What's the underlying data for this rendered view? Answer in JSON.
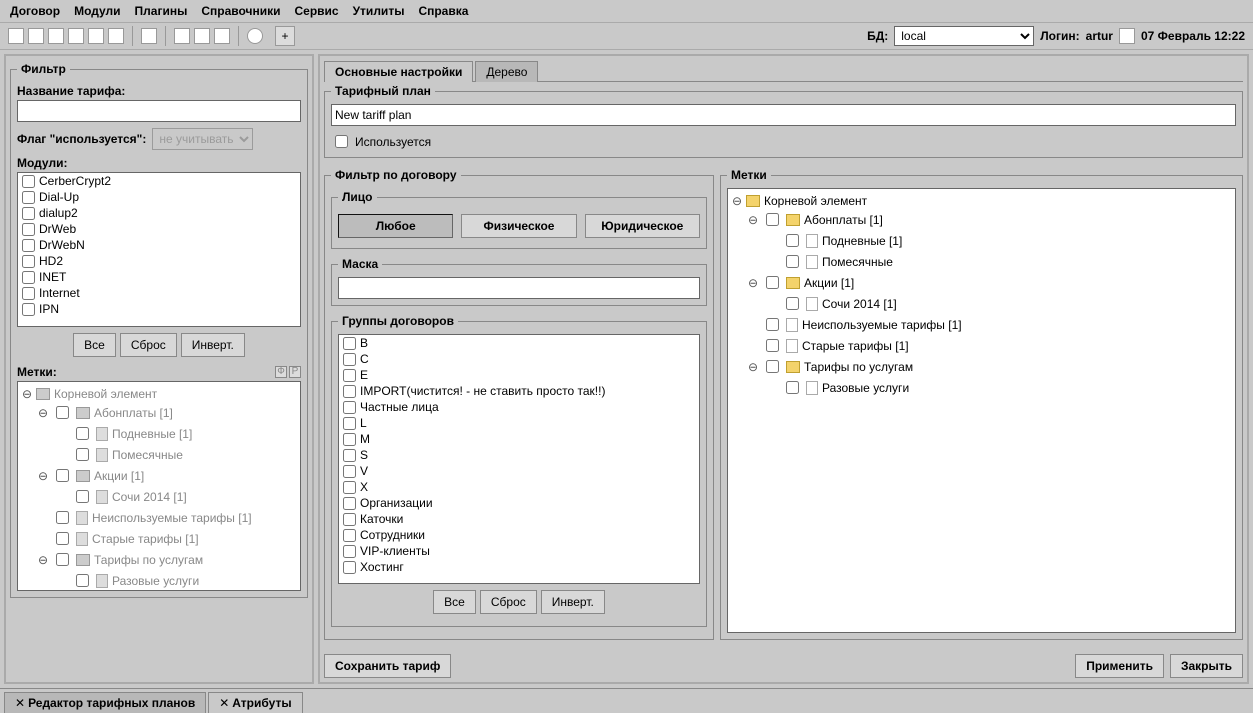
{
  "menu": [
    "Договор",
    "Модули",
    "Плагины",
    "Справочники",
    "Сервис",
    "Утилиты",
    "Справка"
  ],
  "header": {
    "bd_label": "БД:",
    "bd_value": "local",
    "login_label": "Логин:",
    "login_value": "artur",
    "date": "07 Февраль 12:22"
  },
  "filter": {
    "legend": "Фильтр",
    "tariff_name_label": "Название тарифа:",
    "tariff_name_value": "",
    "flag_label": "Флаг \"используется\":",
    "flag_value": "не учитывать",
    "modules_label": "Модули:",
    "modules": [
      "CerberCrypt2",
      "Dial-Up",
      "dialup2",
      "DrWeb",
      "DrWebN",
      "HD2",
      "INET",
      "Internet",
      "IPN"
    ],
    "btn_all": "Все",
    "btn_reset": "Сброс",
    "btn_invert": "Инверт.",
    "labels_label": "Метки:",
    "tree": [
      {
        "lvl": 0,
        "type": "root",
        "twisty": "⊖",
        "label": "Корневой элемент"
      },
      {
        "lvl": 1,
        "type": "fold",
        "twisty": "⊖",
        "cb": true,
        "label": "Абонплаты [1]"
      },
      {
        "lvl": 2,
        "type": "file",
        "cb": true,
        "label": "Подневные [1]"
      },
      {
        "lvl": 2,
        "type": "file",
        "cb": true,
        "label": "Помесячные"
      },
      {
        "lvl": 1,
        "type": "fold",
        "twisty": "⊖",
        "cb": true,
        "label": "Акции [1]"
      },
      {
        "lvl": 2,
        "type": "file",
        "cb": true,
        "label": "Сочи 2014 [1]"
      },
      {
        "lvl": 1,
        "type": "file",
        "cb": true,
        "label": "Неиспользуемые тарифы [1]"
      },
      {
        "lvl": 1,
        "type": "file",
        "cb": true,
        "label": "Старые тарифы [1]"
      },
      {
        "lvl": 1,
        "type": "fold",
        "twisty": "⊖",
        "cb": true,
        "label": "Тарифы по услугам"
      },
      {
        "lvl": 2,
        "type": "file",
        "cb": true,
        "label": "Разовые услуги"
      }
    ]
  },
  "tabs": [
    "Основные настройки",
    "Дерево"
  ],
  "active_tab": 0,
  "plan": {
    "legend": "Тарифный план",
    "name_value": "New tariff plan",
    "used_label": "Используется"
  },
  "contract_filter": {
    "legend": "Фильтр по договору",
    "face_legend": "Лицо",
    "face_buttons": [
      "Любое",
      "Физическое",
      "Юридическое"
    ],
    "face_active": 0,
    "mask_legend": "Маска",
    "mask_value": "",
    "groups_legend": "Группы договоров",
    "groups": [
      "B",
      "C",
      "E",
      "IMPORT(чистится! - не ставить просто так!!)",
      "Частные лица",
      "L",
      "M",
      "S",
      "V",
      "X",
      "Организации",
      "Каточки",
      "Сотрудники",
      "VIP-клиенты",
      "Хостинг"
    ],
    "btn_all": "Все",
    "btn_reset": "Сброс",
    "btn_invert": "Инверт."
  },
  "labels_panel": {
    "legend": "Метки",
    "tree": [
      {
        "lvl": 0,
        "type": "root",
        "twisty": "⊖",
        "label": "Корневой элемент"
      },
      {
        "lvl": 1,
        "type": "fold",
        "twisty": "⊖",
        "cb": true,
        "label": "Абонплаты [1]"
      },
      {
        "lvl": 2,
        "type": "file",
        "cb": true,
        "label": "Подневные [1]"
      },
      {
        "lvl": 2,
        "type": "file",
        "cb": true,
        "label": "Помесячные"
      },
      {
        "lvl": 1,
        "type": "fold",
        "twisty": "⊖",
        "cb": true,
        "label": "Акции [1]"
      },
      {
        "lvl": 2,
        "type": "file",
        "cb": true,
        "label": "Сочи 2014 [1]"
      },
      {
        "lvl": 1,
        "type": "file",
        "cb": true,
        "label": "Неиспользуемые тарифы [1]"
      },
      {
        "lvl": 1,
        "type": "file",
        "cb": true,
        "label": "Старые тарифы [1]"
      },
      {
        "lvl": 1,
        "type": "fold",
        "twisty": "⊖",
        "cb": true,
        "label": "Тарифы по услугам"
      },
      {
        "lvl": 2,
        "type": "file",
        "cb": true,
        "label": "Разовые услуги"
      }
    ]
  },
  "footer": {
    "save": "Сохранить тариф",
    "apply": "Применить",
    "close": "Закрыть"
  },
  "bottom_tabs": [
    "Редактор тарифных планов",
    "Атрибуты"
  ],
  "bottom_active": 1
}
